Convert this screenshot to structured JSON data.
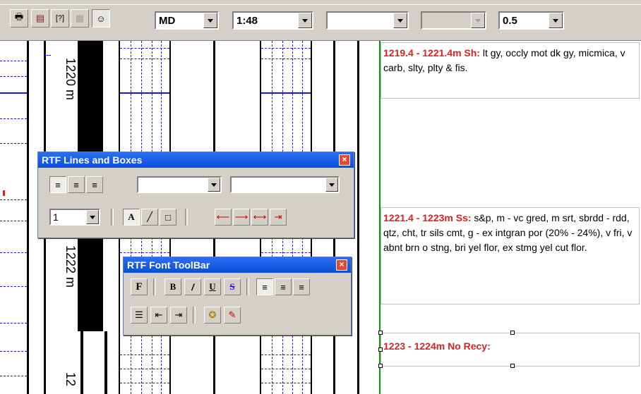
{
  "toolbar": {
    "buttons": [
      {
        "name": "print-icon",
        "glyph": "🖶"
      },
      {
        "name": "report-icon",
        "glyph": "▤"
      },
      {
        "name": "bracket-icon",
        "glyph": "[?]"
      },
      {
        "name": "disabled-icon",
        "glyph": "▦"
      },
      {
        "name": "face-icon",
        "glyph": "☺"
      }
    ],
    "depth_mode": "MD",
    "scale": "1:48",
    "combo3": "",
    "combo4": "",
    "zoom": "0.5"
  },
  "tracks": {
    "depth_label_1": "1220 m",
    "depth_label_2": "1222 m",
    "depth_label_3": "12"
  },
  "descriptions": [
    {
      "head": "1219.4 - 1221.4m Sh:",
      "body": " lt gy, occly mot dk gy, micmica, v carb, slty, plty & fis."
    },
    {
      "head": "1221.4 - 1223m Ss:",
      "body": " s&p, m - vc gred, m srt, sbrdd - rdd, qtz, cht, tr sils cmt, g - ex intgran por (20% - 24%), v fri, v abnt brn o stng, bri yel flor, ex stmg yel cut flor."
    },
    {
      "head": "1223 - 1224m No Recy:",
      "body": ""
    }
  ],
  "lines_panel": {
    "title": "RTF Lines and Boxes",
    "close": "×",
    "line_width": "1",
    "combo_a": "",
    "combo_b": ""
  },
  "font_panel": {
    "title": "RTF Font ToolBar",
    "close": "×"
  },
  "colors": {
    "title_bar": "#0a4fd8",
    "heading_red": "#e02020",
    "grid_blue": "#1b1bd0",
    "divider_green": "#00a000"
  }
}
